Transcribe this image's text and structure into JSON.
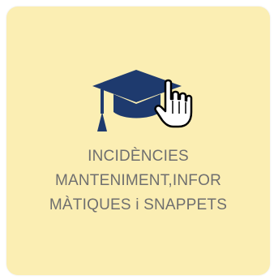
{
  "tile": {
    "icon": "graduation-cap-icon",
    "cursor": "hand-pointer-icon",
    "label_lines": [
      "INCIDÈNCIES",
      "MANTENIMENT,INFOR",
      "MÀTIQUES i SNAPPETS"
    ],
    "colors": {
      "background": "#fbeeb3",
      "icon": "#1e3a6e",
      "text": "#6f6f6f"
    }
  }
}
